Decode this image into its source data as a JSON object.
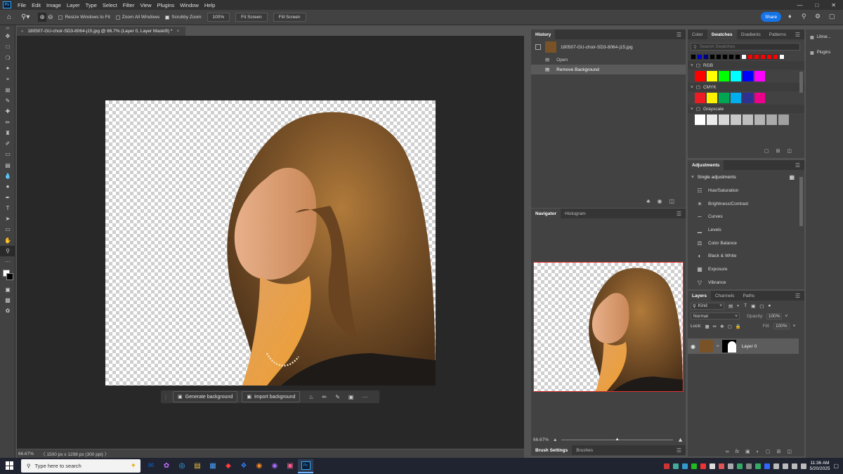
{
  "menubar": {
    "items": [
      "File",
      "Edit",
      "Image",
      "Layer",
      "Type",
      "Select",
      "Filter",
      "View",
      "Plugins",
      "Window",
      "Help"
    ]
  },
  "options": {
    "resize_windows": "Resize Windows to Fit",
    "zoom_all": "Zoom All Windows",
    "scrubby_zoom": "Scrubby Zoom",
    "zoom_value": "100%",
    "fit_screen": "Fit Screen",
    "fill_screen": "Fill Screen",
    "share": "Share"
  },
  "document": {
    "tab_title": "180507-GU-choir-SD3-8064-j15.jpg @ 66.7% (Layer 0, Layer Mask/8) *"
  },
  "contextual_bar": {
    "generate_background": "Generate background",
    "import_background": "Import background"
  },
  "status": {
    "zoom": "66.67%",
    "doc_info": "1500 px x 1298 px (300 ppi)"
  },
  "history": {
    "tabs": [
      "History"
    ],
    "snapshot": "180507-GU-choir-SD3-8064-j15.jpg",
    "steps": [
      "Open",
      "Remove Background"
    ]
  },
  "navigator": {
    "tabs": [
      "Navigator",
      "Histogram"
    ],
    "zoom": "66.67%"
  },
  "brush": {
    "tabs": [
      "Brush Settings",
      "Brushes"
    ]
  },
  "swatches": {
    "tabs": [
      "Color",
      "Swatches",
      "Gradients",
      "Patterns"
    ],
    "search_placeholder": "Search Swatches",
    "recent": [
      "#000000",
      "#0000cc",
      "#000080",
      "#000000",
      "#000000",
      "#000000",
      "#000000",
      "#000000",
      "#ffffff",
      "#ff0000",
      "#ff0000",
      "#ff0000",
      "#ff0000",
      "#ff0000",
      "#ffffff"
    ],
    "groups": [
      {
        "name": "RGB",
        "colors": [
          "#ff0000",
          "#ffff00",
          "#00ff00",
          "#00ffff",
          "#0000ff",
          "#ff00ff"
        ]
      },
      {
        "name": "CMYK",
        "colors": [
          "#ed1c24",
          "#fff200",
          "#00a651",
          "#00aeef",
          "#2e3192",
          "#ec008c"
        ]
      },
      {
        "name": "Grayscale",
        "colors": [
          "#ffffff",
          "#ebebeb",
          "#d6d6d6",
          "#c8c8c8",
          "#bebebe",
          "#b4b4b4",
          "#aaaaaa",
          "#a0a0a0"
        ]
      }
    ]
  },
  "adjustments": {
    "tabs": [
      "Adjustments"
    ],
    "heading": "Single adjustments",
    "items": [
      "Hue/Saturation",
      "Brightness/Contrast",
      "Curves",
      "Levels",
      "Color Balance",
      "Black & White",
      "Exposure",
      "Vibrance"
    ]
  },
  "layers": {
    "tabs": [
      "Layers",
      "Channels",
      "Paths"
    ],
    "kind": "Kind",
    "blend_mode": "Normal",
    "opacity_label": "Opacity:",
    "opacity": "100%",
    "lock_label": "Lock:",
    "fill_label": "Fill:",
    "fill": "100%",
    "layer_name": "Layer 0"
  },
  "libraries": {
    "items": [
      "Librar...",
      "Plugins"
    ]
  },
  "taskbar": {
    "search_placeholder": "Type here to search",
    "time": "11:36 AM",
    "date": "5/20/2025"
  }
}
